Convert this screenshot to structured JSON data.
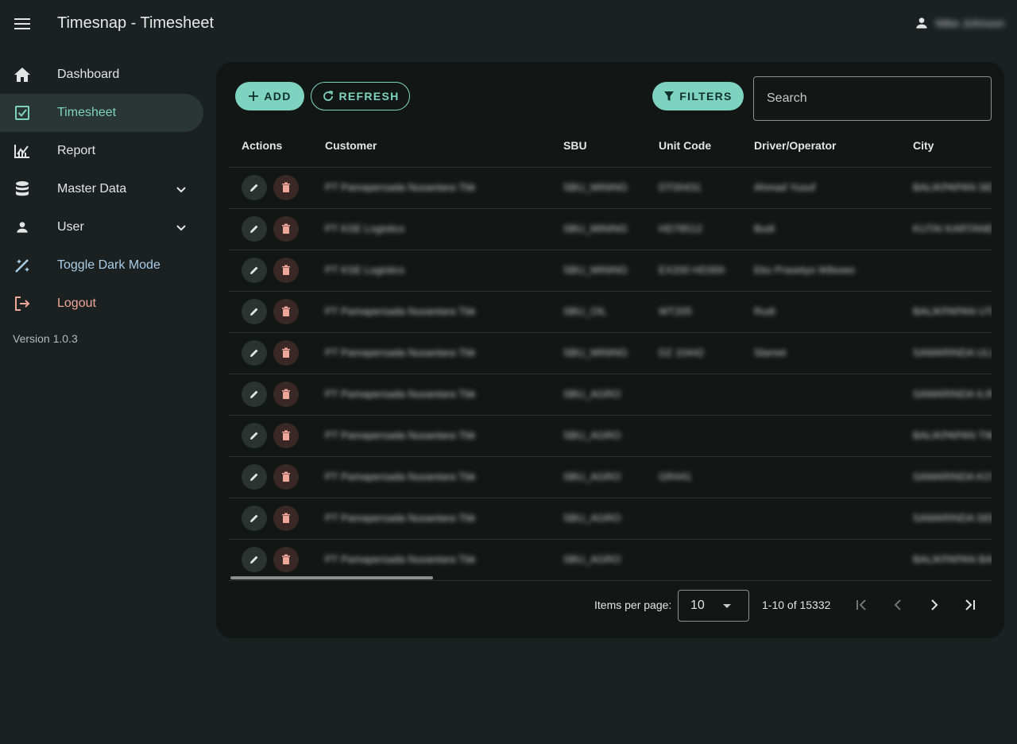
{
  "header": {
    "title": "Timesnap - Timesheet",
    "user_name": "Mike Johnson"
  },
  "sidebar": {
    "items": [
      {
        "label": "Dashboard",
        "icon": "home-icon"
      },
      {
        "label": "Timesheet",
        "icon": "checkbox-icon"
      },
      {
        "label": "Report",
        "icon": "chart-icon"
      },
      {
        "label": "Master Data",
        "icon": "database-icon"
      },
      {
        "label": "User",
        "icon": "person-icon"
      },
      {
        "label": "Toggle Dark Mode",
        "icon": "magic-wand-icon"
      },
      {
        "label": "Logout",
        "icon": "logout-icon"
      }
    ],
    "version": "Version 1.0.3"
  },
  "toolbar": {
    "add_label": "ADD",
    "refresh_label": "REFRESH",
    "filters_label": "FILTERS",
    "search_placeholder": "Search"
  },
  "table": {
    "columns": [
      "Actions",
      "Customer",
      "SBU",
      "Unit Code",
      "Driver/Operator",
      "City"
    ],
    "rows": [
      {
        "customer": "PT Pamapersada Nusantara Tbk",
        "sbu": "SBU_MINING",
        "unit": "DT00431",
        "driver": "Ahmad Yusuf",
        "city": "BALIKPAPAN SELATAN"
      },
      {
        "customer": "PT KSE Logistics",
        "sbu": "SBU_MINING",
        "unit": "HD78512",
        "driver": "Budi",
        "city": "KUTAI KARTANEGARA"
      },
      {
        "customer": "PT KSE Logistics",
        "sbu": "SBU_MINING",
        "unit": "EX200 HD300",
        "driver": "Eko Prasetyo Wibowo",
        "city": ""
      },
      {
        "customer": "PT Pamapersada Nusantara Tbk",
        "sbu": "SBU_OIL",
        "unit": "WT205",
        "driver": "Rudi",
        "city": "BALIKPAPAN UTARA"
      },
      {
        "customer": "PT Pamapersada Nusantara Tbk",
        "sbu": "SBU_MINING",
        "unit": "DZ 10442",
        "driver": "Slamet",
        "city": "SAMARINDA ULU"
      },
      {
        "customer": "PT Pamapersada Nusantara Tbk",
        "sbu": "SBU_AGRO",
        "unit": "",
        "driver": "",
        "city": "SAMARINDA ILIR"
      },
      {
        "customer": "PT Pamapersada Nusantara Tbk",
        "sbu": "SBU_AGRO",
        "unit": "",
        "driver": "",
        "city": "BALIKPAPAN TIMUR"
      },
      {
        "customer": "PT Pamapersada Nusantara Tbk",
        "sbu": "SBU_AGRO",
        "unit": "GR441",
        "driver": "",
        "city": "SAMARINDA KOTA"
      },
      {
        "customer": "PT Pamapersada Nusantara Tbk",
        "sbu": "SBU_AGRO",
        "unit": "",
        "driver": "",
        "city": "SAMARINDA SEBERANG"
      },
      {
        "customer": "PT Pamapersada Nusantara Tbk",
        "sbu": "SBU_AGRO",
        "unit": "",
        "driver": "",
        "city": "BALIKPAPAN BARAT"
      }
    ]
  },
  "paginator": {
    "items_per_page_label": "Items per page:",
    "items_per_page": "10",
    "range": "1-10 of 15332"
  },
  "colors": {
    "accent": "#7ed3c0",
    "background": "#1b2120",
    "card": "#121715",
    "danger": "#f0a79a"
  }
}
